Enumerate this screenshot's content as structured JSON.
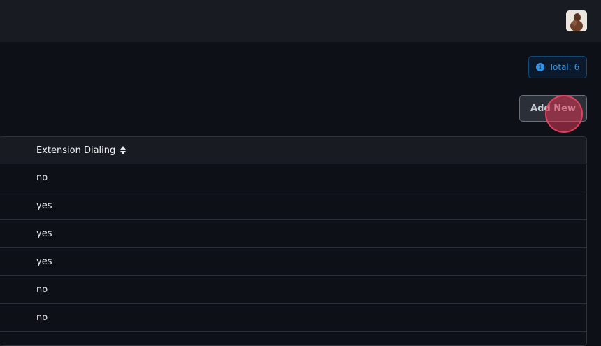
{
  "header": {
    "avatar_icon": "user-avatar-icon"
  },
  "summary": {
    "total_label": "Total: 6"
  },
  "actions": {
    "add_new_label": "Add New"
  },
  "table": {
    "columns": [
      "Extension Dialing"
    ],
    "rows": [
      {
        "extension_dialing": "no"
      },
      {
        "extension_dialing": "yes"
      },
      {
        "extension_dialing": "yes"
      },
      {
        "extension_dialing": "yes"
      },
      {
        "extension_dialing": "no"
      },
      {
        "extension_dialing": "no"
      }
    ]
  },
  "colors": {
    "topbar": "#181c22",
    "background": "#0d1017",
    "badge_accent": "#2f95ea",
    "click_marker": "#dc3755"
  }
}
